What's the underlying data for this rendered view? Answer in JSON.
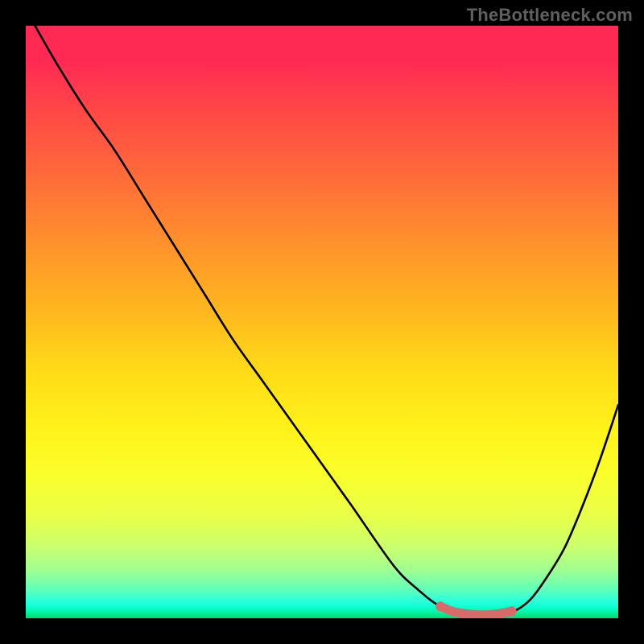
{
  "watermark": "TheBottleneck.com",
  "chart_data": {
    "type": "line",
    "title": "",
    "xlabel": "",
    "ylabel": "",
    "xlim": [
      0,
      100
    ],
    "ylim": [
      0,
      100
    ],
    "series": [
      {
        "name": "bottleneck-curve",
        "x": [
          1,
          5,
          10,
          15,
          20,
          25,
          30,
          35,
          40,
          45,
          50,
          55,
          62,
          66,
          70,
          74,
          77,
          79,
          82,
          85,
          88,
          91,
          94,
          97,
          100
        ],
        "y": [
          101,
          94,
          86,
          79,
          71,
          63,
          55,
          47,
          40,
          33,
          26,
          19,
          9,
          5,
          2,
          1,
          0.5,
          0.5,
          1,
          3,
          7,
          12,
          19,
          27,
          36
        ]
      },
      {
        "name": "highlight-segment",
        "x": [
          70,
          72,
          74,
          76,
          78,
          80,
          82
        ],
        "y": [
          2,
          1.2,
          0.8,
          0.6,
          0.6,
          0.8,
          1.2
        ]
      }
    ],
    "accent_colors": {
      "curve": "#000000",
      "highlight": "#d96a6a"
    }
  }
}
